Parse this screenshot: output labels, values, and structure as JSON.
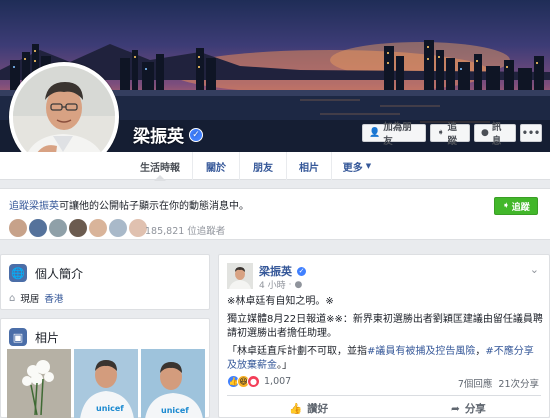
{
  "profile": {
    "name": "梁振英",
    "verified": true
  },
  "cover_buttons": {
    "add_friend": "加為朋友",
    "follow": "追蹤",
    "message": "訊息"
  },
  "tabs": [
    {
      "label": "生活時報",
      "active": true
    },
    {
      "label": "關於",
      "active": false
    },
    {
      "label": "朋友",
      "active": false
    },
    {
      "label": "相片",
      "active": false
    },
    {
      "label": "更多",
      "active": false
    }
  ],
  "follow_prompt": {
    "link": "追蹤梁振英",
    "text": "可讓他的公開帖子顯示在你的動態消息中。",
    "button": "追蹤",
    "follower_count": "185,821 位追蹤者"
  },
  "intro": {
    "title": "個人簡介",
    "lives_in_label": "現居",
    "lives_in_place": "香港"
  },
  "photos": {
    "title": "相片"
  },
  "post": {
    "author": "梁振英",
    "time": "4 小時",
    "headline": "※林卓廷有自知之明。※",
    "body1": "獨立媒體8月22日報道※※：新界東初選勝出者劉穎匡建議由留任議員聘請初選勝出者擔任助理。",
    "quote_prefix": "「林卓廷直斥計劃不可取，並指",
    "quote_tag1": "#議員有被捕及控告風險",
    "quote_mid": "，",
    "quote_tag2": "#不應分享及放棄薪金",
    "quote_suffix": "。」",
    "reactions_count": "1,007",
    "comments_count": "7個回應",
    "shares_count": "21次分享",
    "like_label": "讚好",
    "share_label": "分享"
  },
  "colors": {
    "facebook_blue": "#365899",
    "follow_green": "#42b72a",
    "verified_blue": "#4080ff"
  }
}
